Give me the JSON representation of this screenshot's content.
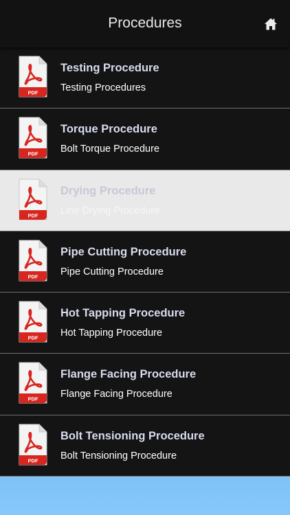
{
  "header": {
    "title": "Procedures",
    "home_icon": "home-icon"
  },
  "list": {
    "pdf_label": "PDF",
    "selected_index": 2,
    "items": [
      {
        "title": "Testing Procedure",
        "subtitle": "Testing Procedures"
      },
      {
        "title": "Torque Procedure",
        "subtitle": "Bolt Torque Procedure"
      },
      {
        "title": "Drying Procedure",
        "subtitle": "Line Drying Procedure"
      },
      {
        "title": "Pipe Cutting Procedure",
        "subtitle": "Pipe Cutting Procedure"
      },
      {
        "title": "Hot Tapping Procedure",
        "subtitle": "Hot Tapping Procedure"
      },
      {
        "title": "Flange Facing Procedure",
        "subtitle": "Flange Facing Procedure"
      },
      {
        "title": "Bolt Tensioning Procedure",
        "subtitle": "Bolt Tensioning Procedure"
      }
    ]
  },
  "colors": {
    "background": "#141414",
    "selected_row": "#e9e9e9",
    "title_text": "#d9dcef",
    "pdf_red": "#d7251f",
    "footer": "#82c4f8"
  }
}
